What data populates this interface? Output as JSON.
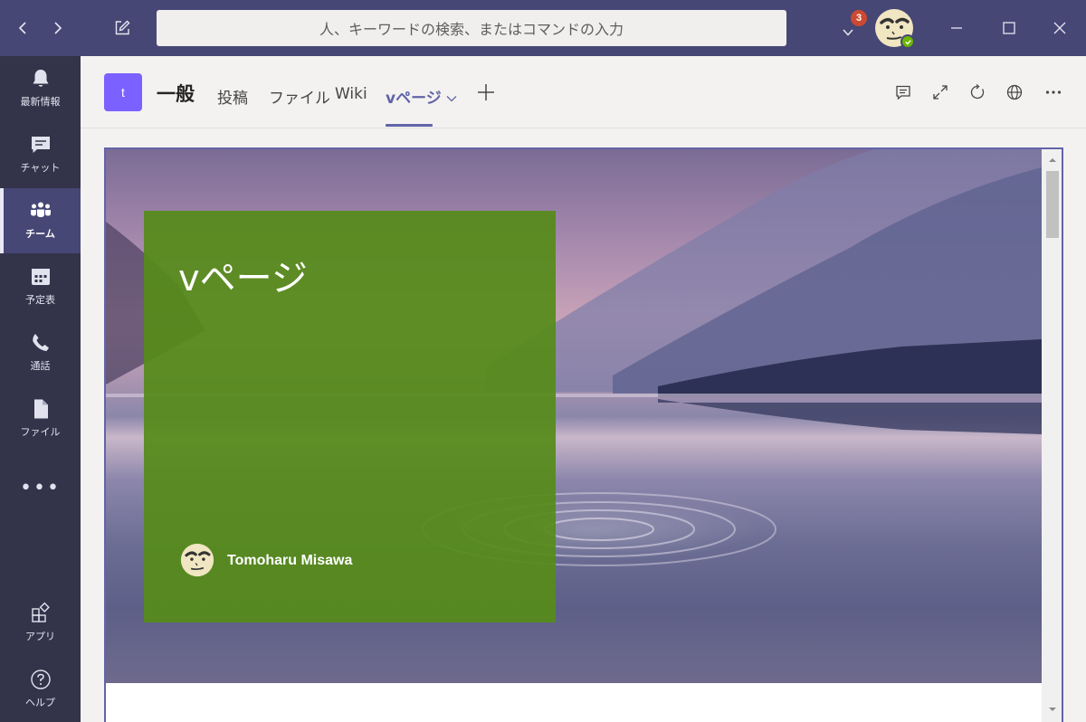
{
  "titlebar": {
    "search_placeholder": "人、キーワードの検索、またはコマンドの入力",
    "notification_count": "3",
    "bg_color": "#464775"
  },
  "rail": {
    "items": [
      {
        "label": "最新情報",
        "icon": "bell-icon"
      },
      {
        "label": "チャット",
        "icon": "chat-icon"
      },
      {
        "label": "チーム",
        "icon": "teams-icon",
        "active": true
      },
      {
        "label": "予定表",
        "icon": "calendar-icon"
      },
      {
        "label": "通話",
        "icon": "phone-icon"
      },
      {
        "label": "ファイル",
        "icon": "file-icon"
      }
    ],
    "more": "•••",
    "bottom_items": [
      {
        "label": "アプリ",
        "icon": "apps-icon"
      },
      {
        "label": "ヘルプ",
        "icon": "help-icon"
      }
    ]
  },
  "header": {
    "team_initial": "t",
    "channel_name": "一般",
    "tabs": [
      {
        "label": "投稿"
      },
      {
        "label": "ファイル"
      },
      {
        "label": "Wiki"
      },
      {
        "label": "vページ",
        "active": true
      }
    ],
    "accent_color": "#6264a7"
  },
  "content": {
    "page_title": "vページ",
    "author": "Tomoharu Misawa",
    "card_color": "#568b1a"
  }
}
